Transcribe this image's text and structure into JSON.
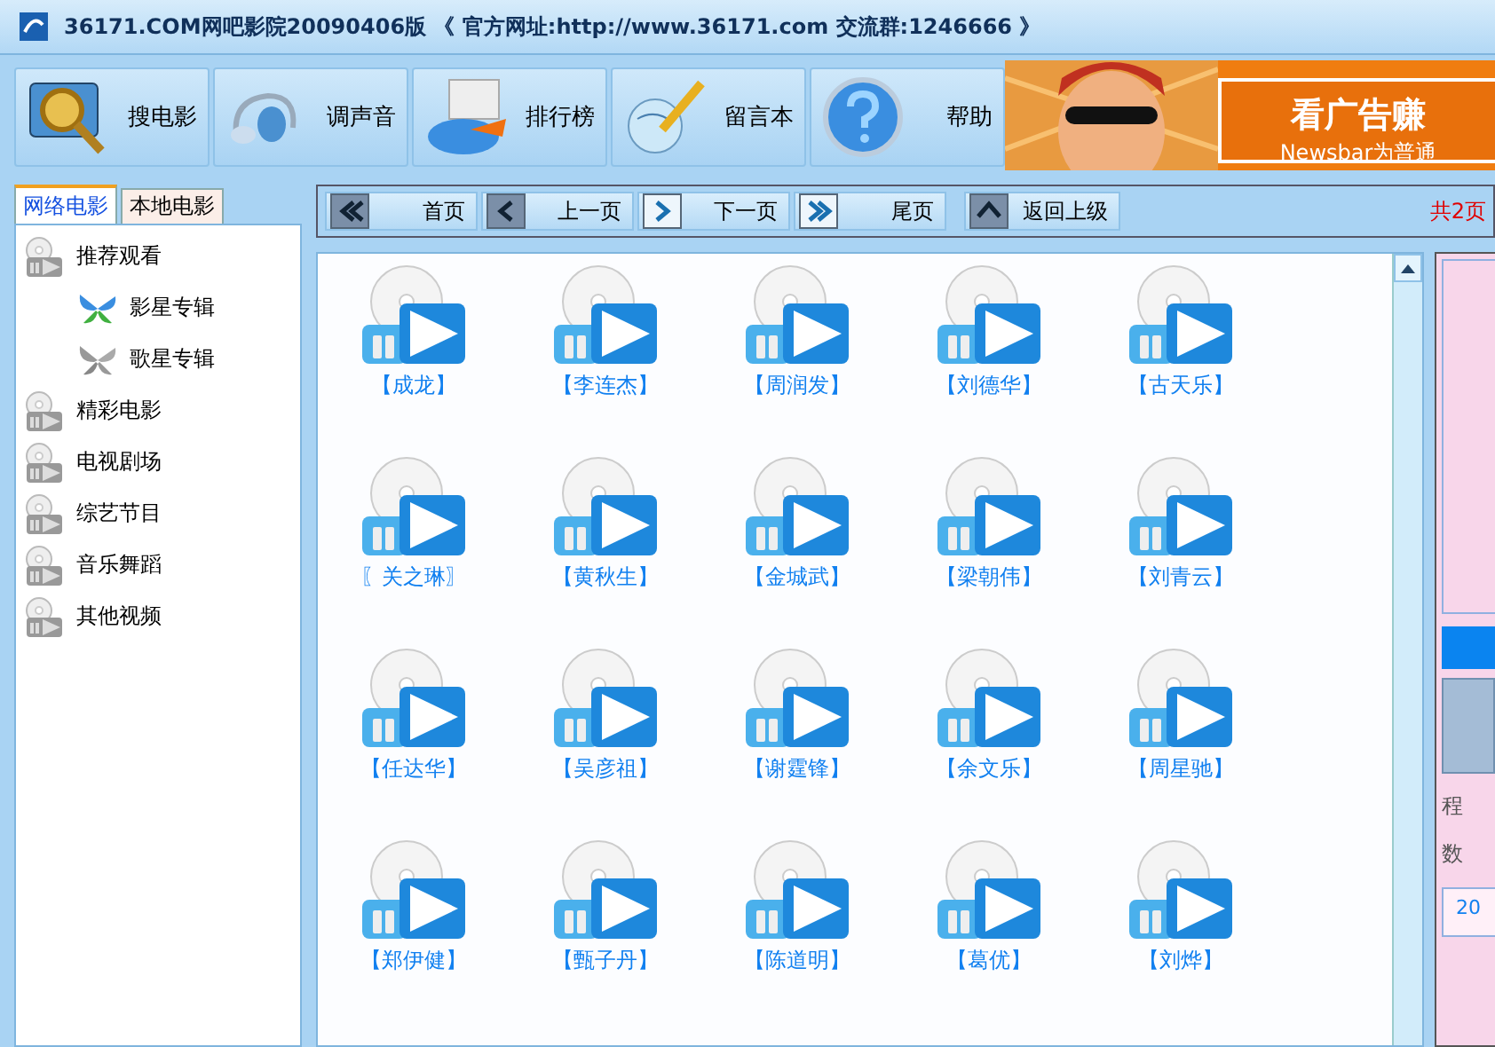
{
  "window": {
    "title": "36171.COM网吧影院20090406版 《 官方网址:http://www.36171.com 交流群:1246666 》"
  },
  "toolbar": [
    {
      "label": "搜电影",
      "kind": "magnifier"
    },
    {
      "label": "调声音",
      "kind": "headphones"
    },
    {
      "label": "排行榜",
      "kind": "chart"
    },
    {
      "label": "留言本",
      "kind": "globe"
    },
    {
      "label": "帮助",
      "kind": "help"
    }
  ],
  "ad": {
    "headline": "看广告赚",
    "subline": "Newsbar为普通"
  },
  "tabs": [
    {
      "label": "网络电影",
      "selected": true
    },
    {
      "label": "本地电影",
      "selected": false
    }
  ],
  "tree": [
    {
      "label": "推荐观看",
      "kind": "disc",
      "children": [
        {
          "label": "影星专辑",
          "kind": "colored"
        },
        {
          "label": "歌星专辑",
          "kind": "gray"
        }
      ]
    },
    {
      "label": "精彩电影",
      "kind": "disc"
    },
    {
      "label": "电视剧场",
      "kind": "disc"
    },
    {
      "label": "综艺节目",
      "kind": "disc"
    },
    {
      "label": "音乐舞蹈",
      "kind": "disc"
    },
    {
      "label": "其他视频",
      "kind": "disc"
    }
  ],
  "nav": [
    {
      "label": "首页",
      "kind": "first"
    },
    {
      "label": "上一页",
      "kind": "prev"
    },
    {
      "label": "下一页",
      "kind": "next"
    },
    {
      "label": "尾页",
      "kind": "last"
    },
    {
      "label": "返回上级",
      "kind": "up"
    }
  ],
  "page_count": "共2页",
  "items": [
    "【成龙】",
    "【李连杰】",
    "【周润发】",
    "【刘德华】",
    "【古天乐】",
    "〖关之琳〗",
    "【黄秋生】",
    "【金城武】",
    "【梁朝伟】",
    "【刘青云】",
    "【任达华】",
    "【吴彦祖】",
    "【谢霆锋】",
    "【余文乐】",
    "【周星驰】",
    "【郑伊健】",
    "【甄子丹】",
    "【陈道明】",
    "【葛优】",
    "【刘烨】"
  ],
  "side_panel": {
    "line_1": "程",
    "line_2": "数",
    "field": "20"
  }
}
